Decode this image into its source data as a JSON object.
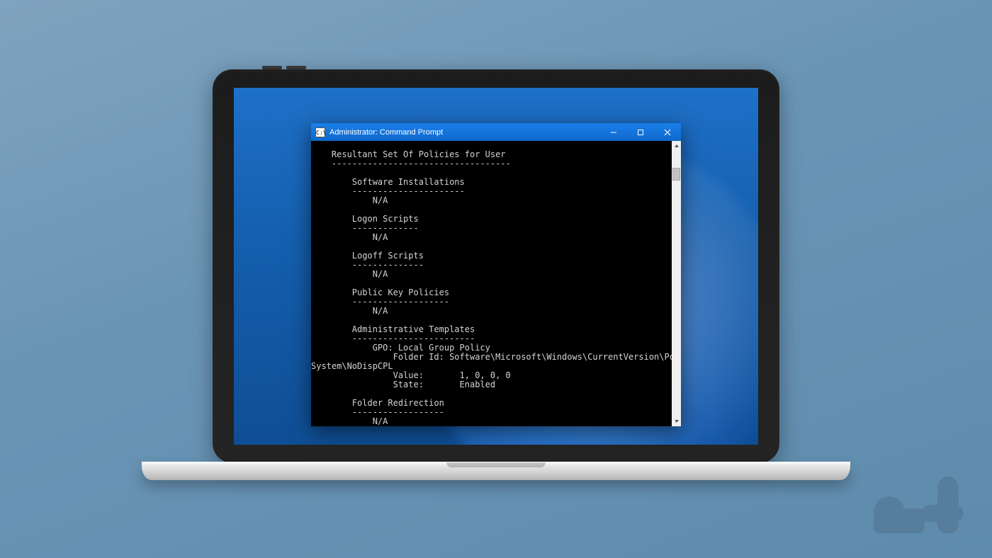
{
  "window": {
    "title": "Administrator: Command Prompt",
    "icon_label": "C:\\",
    "buttons": {
      "minimize": "Minimize",
      "maximize": "Maximize",
      "close": "Close"
    }
  },
  "output": {
    "header": "Resultant Set Of Policies for User",
    "header_div": "-----------------------------------",
    "sections": [
      {
        "title": "Software Installations",
        "div": "----------------------",
        "body": [
          "N/A"
        ]
      },
      {
        "title": "Logon Scripts",
        "div": "-------------",
        "body": [
          "N/A"
        ]
      },
      {
        "title": "Logoff Scripts",
        "div": "--------------",
        "body": [
          "N/A"
        ]
      },
      {
        "title": "Public Key Policies",
        "div": "-------------------",
        "body": [
          "N/A"
        ]
      },
      {
        "title": "Administrative Templates",
        "div": "------------------------",
        "body": [
          "GPO: Local Group Policy",
          "    Folder Id: Software\\Microsoft\\Windows\\CurrentVersion\\Policies\\",
          "System\\NoDispCPL",
          "    Value:       1, 0, 0, 0",
          "    State:       Enabled"
        ],
        "raw_continuation": true
      },
      {
        "title": "Folder Redirection",
        "div": "------------------",
        "body": [
          "N/A"
        ]
      }
    ]
  },
  "watermark": {
    "name": "gt-logo"
  }
}
